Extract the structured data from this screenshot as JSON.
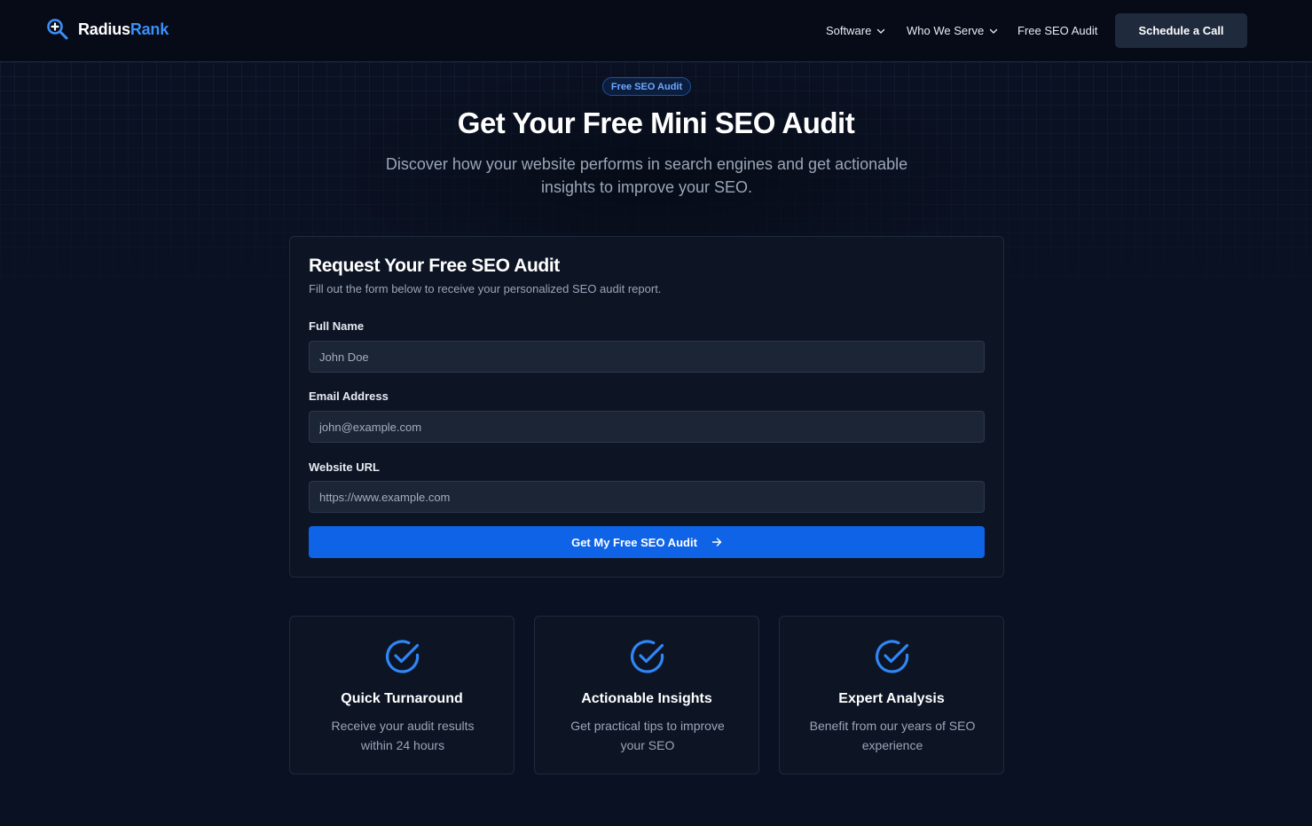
{
  "brand": {
    "name_part1": "Radius",
    "name_part2": "Rank",
    "accent": "#3b8ff6"
  },
  "nav": {
    "items": [
      {
        "label": "Software",
        "has_dropdown": true
      },
      {
        "label": "Who We Serve",
        "has_dropdown": true
      },
      {
        "label": "Free SEO Audit",
        "has_dropdown": false
      }
    ],
    "cta_label": "Schedule a Call"
  },
  "hero": {
    "badge": "Free SEO Audit",
    "title": "Get Your Free Mini SEO Audit",
    "subtitle": "Discover how your website performs in search engines and get actionable insights to improve your SEO."
  },
  "form": {
    "title": "Request Your Free SEO Audit",
    "description": "Fill out the form below to receive your personalized SEO audit report.",
    "fields": [
      {
        "label": "Full Name",
        "placeholder": "John Doe",
        "value": ""
      },
      {
        "label": "Email Address",
        "placeholder": "john@example.com",
        "value": ""
      },
      {
        "label": "Website URL",
        "placeholder": "https://www.example.com",
        "value": ""
      }
    ],
    "submit_label": "Get My Free SEO Audit",
    "submit_color": "#0e63e6"
  },
  "features": [
    {
      "icon": "check-circle-icon",
      "title": "Quick Turnaround",
      "description": "Receive your audit results within 24 hours"
    },
    {
      "icon": "check-circle-icon",
      "title": "Actionable Insights",
      "description": "Get practical tips to improve your SEO"
    },
    {
      "icon": "check-circle-icon",
      "title": "Expert Analysis",
      "description": "Benefit from our years of SEO experience"
    }
  ]
}
